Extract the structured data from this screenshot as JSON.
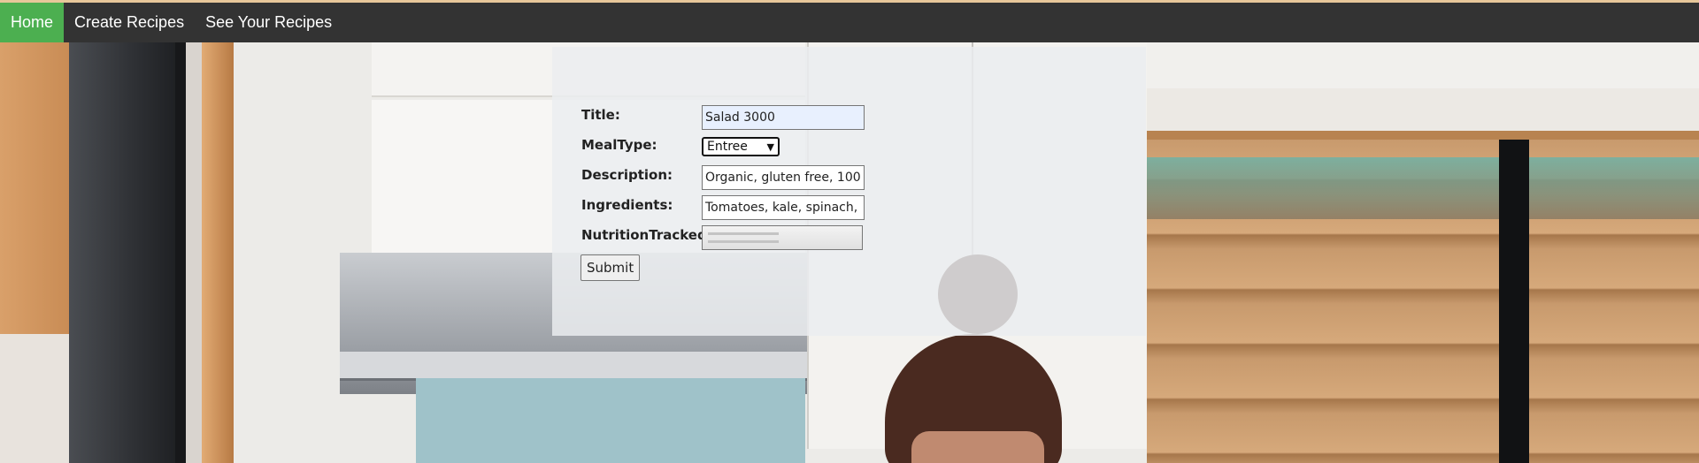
{
  "nav": {
    "items": [
      {
        "label": "Home",
        "active": true
      },
      {
        "label": "Create Recipes",
        "active": false
      },
      {
        "label": "See Your Recipes",
        "active": false
      }
    ],
    "active_color": "#4caf50",
    "bar_color": "#333333"
  },
  "form": {
    "title_label": "Title:",
    "title_value": "Salad 3000",
    "mealtype_label": "MealType:",
    "mealtype_value": "Entree",
    "description_label": "Description:",
    "description_value": "Organic, gluten free, 100",
    "ingredients_label": "Ingredients:",
    "ingredients_value": "Tomatoes, kale, spinach,",
    "nutrition_label": "NutritionTracked:",
    "submit_label": "Submit"
  }
}
